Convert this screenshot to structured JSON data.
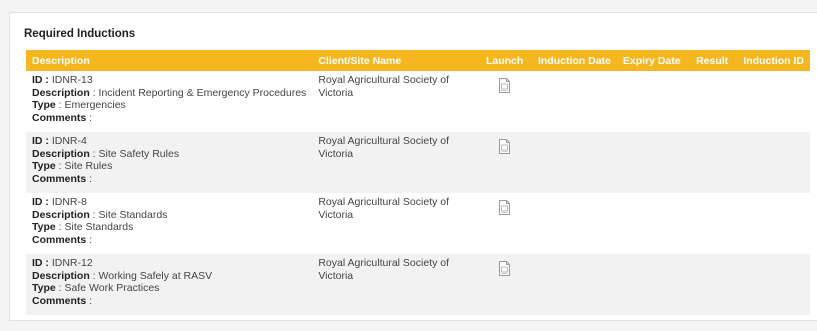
{
  "panel": {
    "title": "Required Inductions"
  },
  "table": {
    "headers": {
      "description": "Description",
      "client": "Client/Site Name",
      "launch": "Launch",
      "induction_date": "Induction Date",
      "expiry_date": "Expiry Date",
      "result": "Result",
      "induction_id": "Induction ID"
    },
    "field_labels": {
      "id": "ID",
      "description": "Description",
      "type": "Type",
      "comments": "Comments"
    },
    "rows": [
      {
        "id": "IDNR-13",
        "description": "Incident Reporting & Emergency Procedures",
        "type": "Emergencies",
        "comments": "",
        "client": "Royal Agricultural Society of Victoria",
        "launch_icon": "document-icon",
        "induction_date": "",
        "expiry_date": "",
        "result": "",
        "induction_id": ""
      },
      {
        "id": "IDNR-4",
        "description": "Site Safety Rules",
        "type": "Site Rules",
        "comments": "",
        "client": "Royal Agricultural Society of Victoria",
        "launch_icon": "document-icon",
        "induction_date": "",
        "expiry_date": "",
        "result": "",
        "induction_id": ""
      },
      {
        "id": "IDNR-8",
        "description": "Site Standards",
        "type": "Site Standards",
        "comments": "",
        "client": "Royal Agricultural Society of Victoria",
        "launch_icon": "document-icon",
        "induction_date": "",
        "expiry_date": "",
        "result": "",
        "induction_id": ""
      },
      {
        "id": "IDNR-12",
        "description": "Working Safely at RASV",
        "type": "Safe Work Practices",
        "comments": "",
        "client": "Royal Agricultural Society of Victoria",
        "launch_icon": "document-icon",
        "induction_date": "",
        "expiry_date": "",
        "result": "",
        "induction_id": ""
      }
    ]
  },
  "colors": {
    "header_bg": "#f6b61f",
    "header_text": "#ffffff",
    "stripe": "#f2f2f2"
  }
}
